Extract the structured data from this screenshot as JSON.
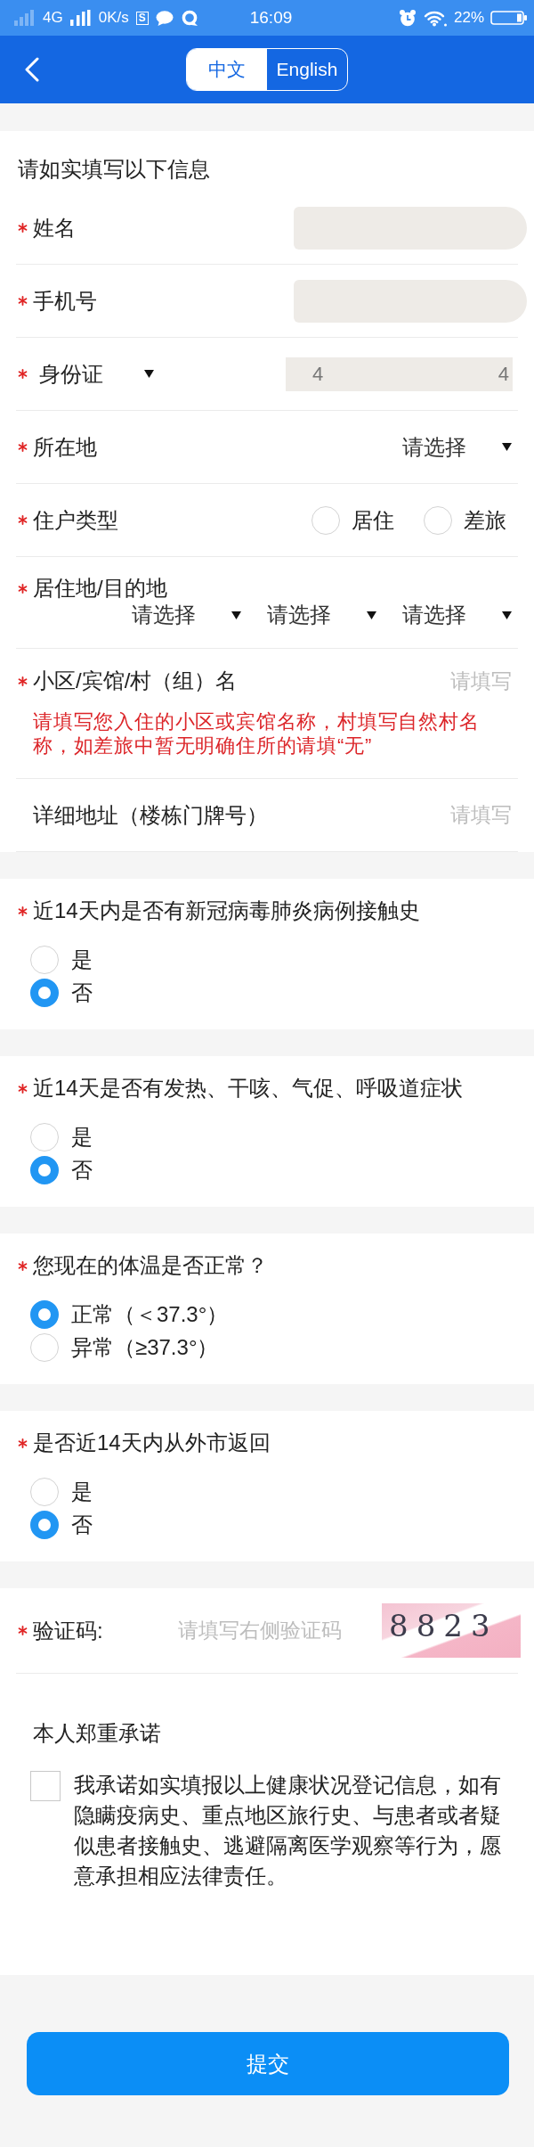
{
  "status_bar": {
    "network": "4G",
    "speed": "0K/s",
    "app_badge": "S",
    "time": "16:09",
    "battery": "22%"
  },
  "header": {
    "languages": [
      {
        "label": "中文",
        "selected": true
      },
      {
        "label": "English",
        "selected": false
      }
    ]
  },
  "form": {
    "intro": "请如实填写以下信息",
    "fields": [
      {
        "kind": "text",
        "label": "姓名",
        "required": true,
        "redacted": true
      },
      {
        "kind": "text",
        "label": "手机号",
        "required": true,
        "redacted": true
      },
      {
        "kind": "id",
        "label": "身份证",
        "required": true,
        "redacted": true,
        "value_start": "4",
        "value_end": "4"
      },
      {
        "kind": "select",
        "label": "所在地",
        "required": true,
        "selects": [
          "请选择"
        ]
      },
      {
        "kind": "radio",
        "label": "住户类型",
        "required": true,
        "options": [
          {
            "label": "居住",
            "selected": false
          },
          {
            "label": "差旅",
            "selected": false
          }
        ]
      },
      {
        "kind": "multi_select",
        "label": "居住地/目的地",
        "required": true,
        "selects": [
          "请选择",
          "请选择",
          "请选择"
        ]
      },
      {
        "kind": "text",
        "label": "小区/宾馆/村（组）名",
        "required": true,
        "redacted": false,
        "placeholder": "请填写",
        "hint": "请填写您入住的小区或宾馆名称，村填写自然村名称，如差旅中暂无明确住所的请填“无”"
      },
      {
        "kind": "text",
        "label": "详细地址（楼栋门牌号）",
        "required": false,
        "redacted": false,
        "placeholder": "请填写"
      }
    ]
  },
  "questions": [
    {
      "text": "近14天内是否有新冠病毒肺炎病例接触史",
      "required": true,
      "options": [
        {
          "label": "是",
          "selected": false
        },
        {
          "label": "否",
          "selected": true
        }
      ]
    },
    {
      "text": "近14天是否有发热、干咳、气促、呼吸道症状",
      "required": true,
      "options": [
        {
          "label": "是",
          "selected": false
        },
        {
          "label": "否",
          "selected": true
        }
      ]
    },
    {
      "text": "您现在的体温是否正常？",
      "required": true,
      "options": [
        {
          "label": "正常（＜37.3°）",
          "selected": true
        },
        {
          "label": "异常（≥37.3°）",
          "selected": false
        }
      ]
    },
    {
      "text": "是否近14天内从外市返回",
      "required": true,
      "options": [
        {
          "label": "是",
          "selected": false
        },
        {
          "label": "否",
          "selected": true
        }
      ]
    }
  ],
  "captcha": {
    "label": "验证码:",
    "required": true,
    "placeholder": "请填写右侧验证码",
    "image_text": "8823"
  },
  "pledge": {
    "title": "本人郑重承诺",
    "checked": false,
    "text": "我承诺如实填报以上健康状况登记信息，如有隐瞒疫病史、重点地区旅行史、与患者或者疑似患者接触史、逃避隔离医学观察等行为，愿意承担相应法律责任。"
  },
  "submit_button": "提交"
}
